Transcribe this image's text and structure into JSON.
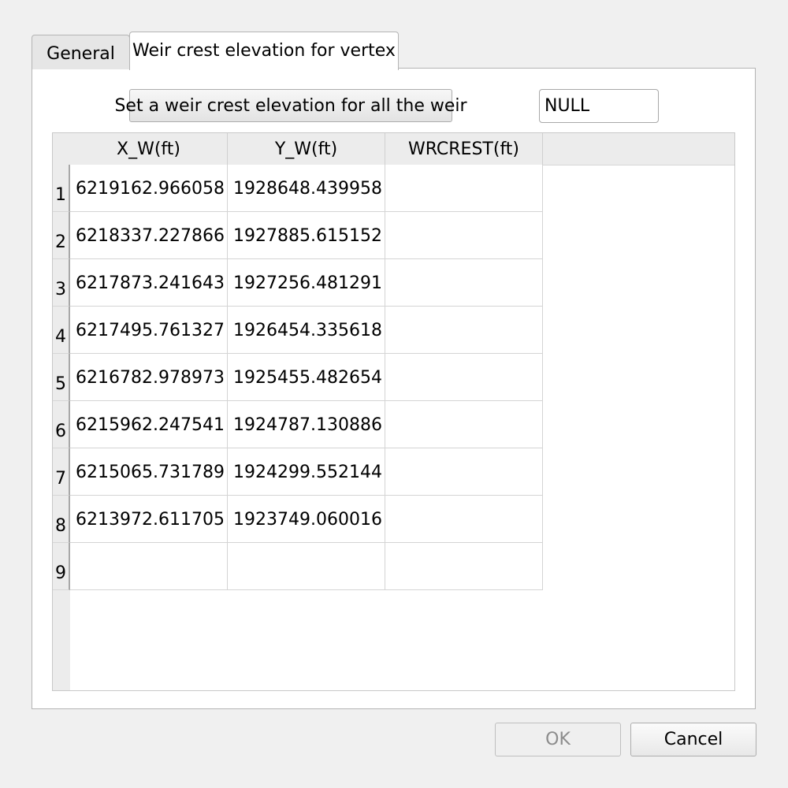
{
  "tabs": [
    {
      "label": "General"
    },
    {
      "label": "Weir crest elevation for vertex"
    }
  ],
  "set_all_button": "Set a weir crest elevation for all the weir",
  "set_all_value": "NULL",
  "table": {
    "columns": [
      "X_W(ft)",
      "Y_W(ft)",
      "WRCREST(ft)"
    ],
    "rows": [
      {
        "num": "1",
        "x": "6219162.966058",
        "y": "1928648.439958",
        "wrcrest": ""
      },
      {
        "num": "2",
        "x": "6218337.227866",
        "y": "1927885.615152",
        "wrcrest": ""
      },
      {
        "num": "3",
        "x": "6217873.241643",
        "y": "1927256.481291",
        "wrcrest": ""
      },
      {
        "num": "4",
        "x": "6217495.761327",
        "y": "1926454.335618",
        "wrcrest": ""
      },
      {
        "num": "5",
        "x": "6216782.978973",
        "y": "1925455.482654",
        "wrcrest": ""
      },
      {
        "num": "6",
        "x": "6215962.247541",
        "y": "1924787.130886",
        "wrcrest": ""
      },
      {
        "num": "7",
        "x": "6215065.731789",
        "y": "1924299.552144",
        "wrcrest": ""
      },
      {
        "num": "8",
        "x": "6213972.611705",
        "y": "1923749.060016",
        "wrcrest": ""
      },
      {
        "num": "9",
        "x": "",
        "y": "",
        "wrcrest": ""
      }
    ]
  },
  "buttons": {
    "ok": "OK",
    "cancel": "Cancel"
  }
}
